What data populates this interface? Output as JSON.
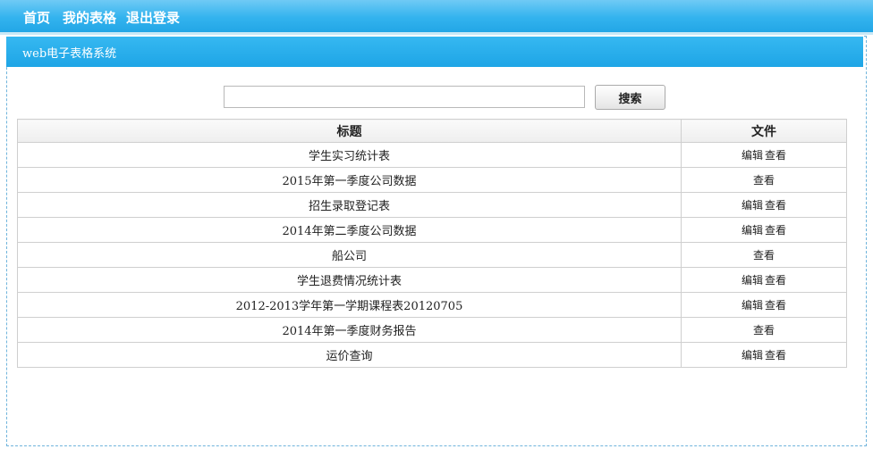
{
  "nav": {
    "home": "首页",
    "my_tables": "我的表格",
    "logout": "退出登录"
  },
  "subheader": {
    "title": "web电子表格系统"
  },
  "search": {
    "value": "",
    "button_label": "搜索"
  },
  "table": {
    "headers": [
      "标题",
      "文件"
    ],
    "rows": [
      {
        "title": "学生实习统计表",
        "actions": [
          "编辑",
          "查看"
        ]
      },
      {
        "title": "2015年第一季度公司数据",
        "actions": [
          "查看"
        ]
      },
      {
        "title": "招生录取登记表",
        "actions": [
          "编辑",
          "查看"
        ]
      },
      {
        "title": "2014年第二季度公司数据",
        "actions": [
          "编辑",
          "查看"
        ]
      },
      {
        "title": "船公司",
        "actions": [
          "查看"
        ]
      },
      {
        "title": "学生退费情况统计表",
        "actions": [
          "编辑",
          "查看"
        ]
      },
      {
        "title": "2012-2013学年第一学期课程表20120705",
        "actions": [
          "编辑",
          "查看"
        ]
      },
      {
        "title": "2014年第一季度财务报告",
        "actions": [
          "查看"
        ]
      },
      {
        "title": "运价查询",
        "actions": [
          "编辑",
          "查看"
        ]
      }
    ]
  },
  "colors": {
    "nav_bg": "#33b3ee",
    "subbar_bg": "#22a6e6",
    "border": "#cfcfcf"
  }
}
